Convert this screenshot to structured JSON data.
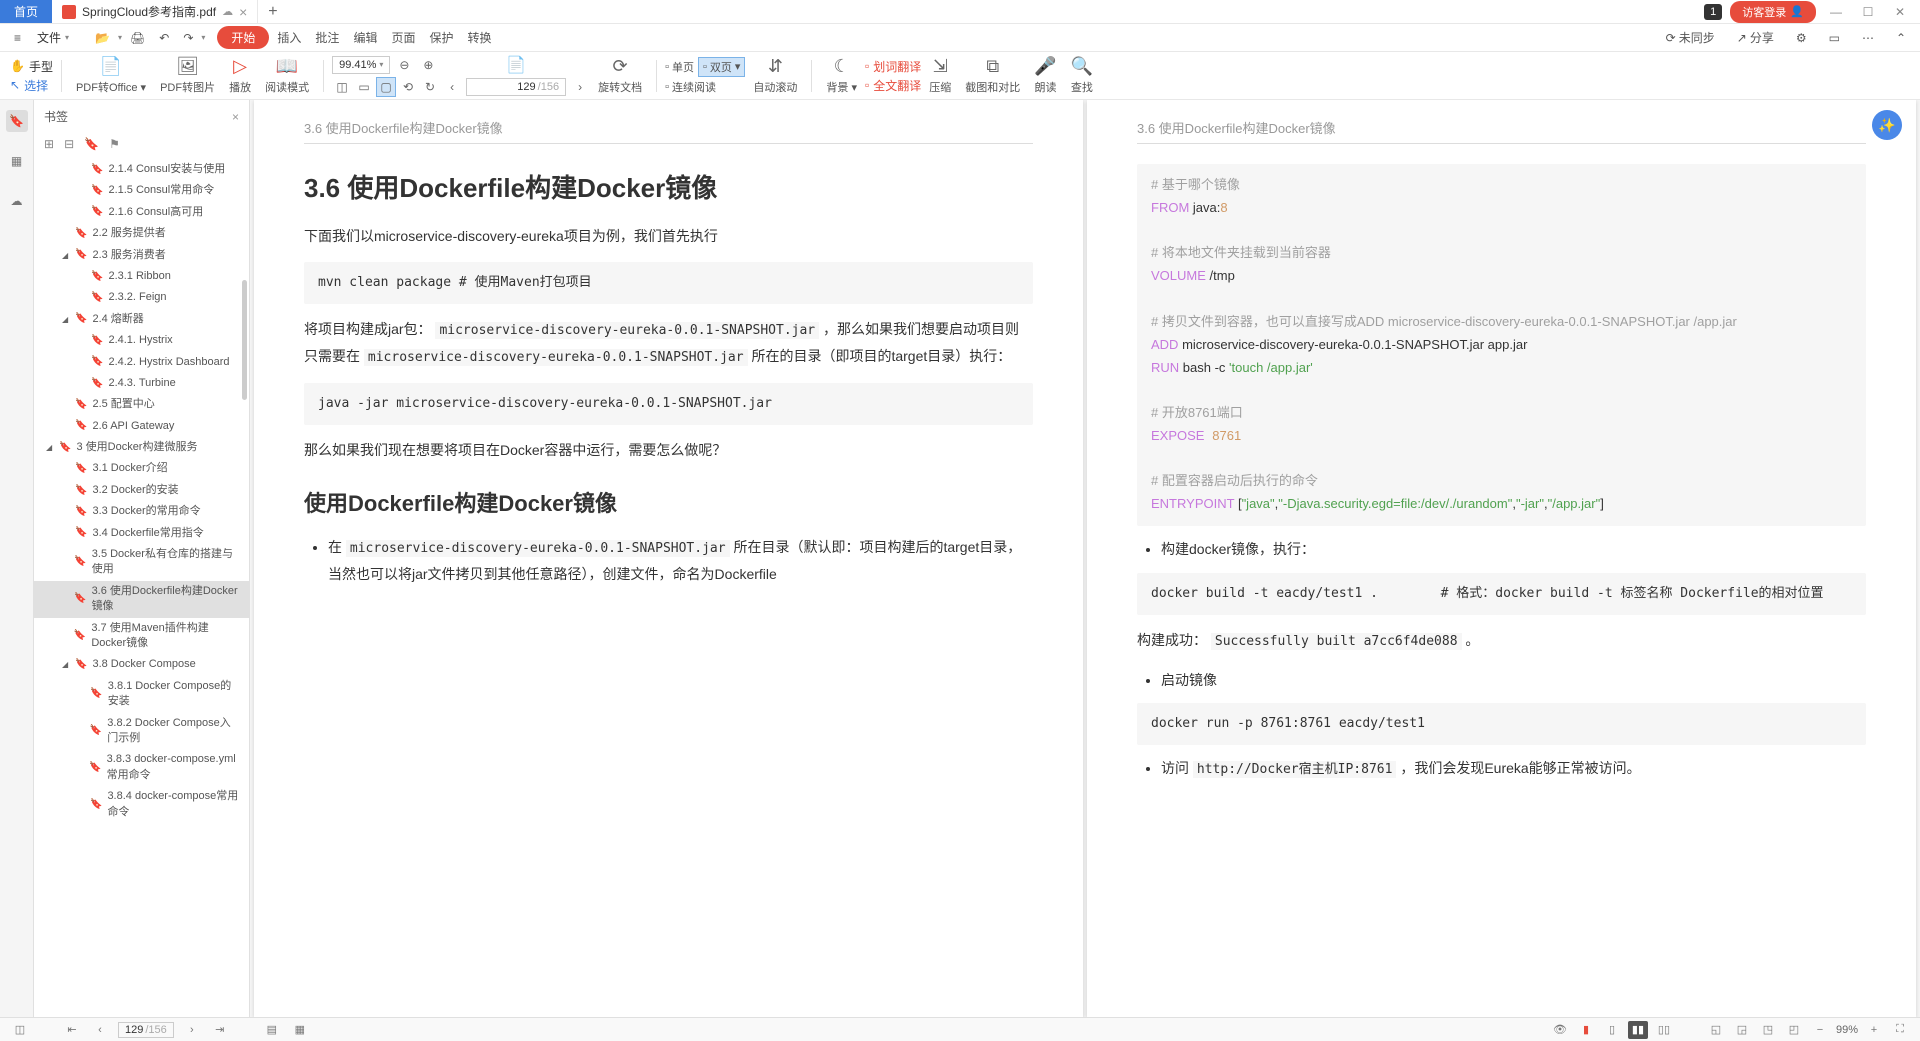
{
  "titlebar": {
    "home": "首页",
    "doc_name": "SpringCloud参考指南.pdf",
    "badge": "1",
    "login": "访客登录"
  },
  "menubar": {
    "file": "文件",
    "start": "开始",
    "insert": "插入",
    "review": "批注",
    "edit": "编辑",
    "page": "页面",
    "protect": "保护",
    "convert": "转换",
    "notsync": "未同步",
    "share": "分享"
  },
  "toolbar": {
    "hand": "手型",
    "select": "选择",
    "pdf2office": "PDF转Office",
    "pdf2img": "PDF转图片",
    "play": "播放",
    "readmode": "阅读模式",
    "zoom": "99.41%",
    "rotate": "旋转文档",
    "singlepage": "单页",
    "doublepage": "双页",
    "contread": "连续阅读",
    "autoscroll": "自动滚动",
    "bg": "背景",
    "seltrans": "划词翻译",
    "fulltrans": "全文翻译",
    "compress": "压缩",
    "imgcmp": "截图和对比",
    "readaloud": "朗读",
    "find": "查找",
    "page_cur": "129",
    "page_total": "/156"
  },
  "bookmark": {
    "title": "书签",
    "items": [
      {
        "label": "2.1.4 Consul安装与使用",
        "lvl": 2
      },
      {
        "label": "2.1.5 Consul常用命令",
        "lvl": 2
      },
      {
        "label": "2.1.6 Consul高可用",
        "lvl": 2
      },
      {
        "label": "2.2 服务提供者",
        "lvl": 1
      },
      {
        "label": "2.3 服务消费者",
        "lvl": 1,
        "exp": true
      },
      {
        "label": "2.3.1 Ribbon",
        "lvl": 2
      },
      {
        "label": "2.3.2. Feign",
        "lvl": 2
      },
      {
        "label": "2.4 熔断器",
        "lvl": 1,
        "exp": true
      },
      {
        "label": "2.4.1. Hystrix",
        "lvl": 2
      },
      {
        "label": "2.4.2. Hystrix Dashboard",
        "lvl": 2
      },
      {
        "label": "2.4.3. Turbine",
        "lvl": 2
      },
      {
        "label": "2.5 配置中心",
        "lvl": 1
      },
      {
        "label": "2.6 API Gateway",
        "lvl": 1
      },
      {
        "label": "3 使用Docker构建微服务",
        "lvl": 0,
        "exp": true
      },
      {
        "label": "3.1 Docker介绍",
        "lvl": 1
      },
      {
        "label": "3.2 Docker的安装",
        "lvl": 1
      },
      {
        "label": "3.3 Docker的常用命令",
        "lvl": 1
      },
      {
        "label": "3.4 Dockerfile常用指令",
        "lvl": 1
      },
      {
        "label": "3.5 Docker私有仓库的搭建与使用",
        "lvl": 1
      },
      {
        "label": "3.6 使用Dockerfile构建Docker镜像",
        "lvl": 1,
        "active": true
      },
      {
        "label": "3.7 使用Maven插件构建Docker镜像",
        "lvl": 1
      },
      {
        "label": "3.8 Docker Compose",
        "lvl": 1,
        "exp": true
      },
      {
        "label": "3.8.1 Docker Compose的安装",
        "lvl": 2
      },
      {
        "label": "3.8.2 Docker Compose入门示例",
        "lvl": 2
      },
      {
        "label": "3.8.3 docker-compose.yml常用命令",
        "lvl": 2
      },
      {
        "label": "3.8.4 docker-compose常用命令",
        "lvl": 2
      }
    ]
  },
  "doc": {
    "header": "3.6 使用Dockerfile构建Docker镜像",
    "left": {
      "h1": "3.6 使用Dockerfile构建Docker镜像",
      "p1a": "下面我们以microservice-discovery-eureka项目为例，我们首先执行",
      "code1": "mvn clean package # 使用Maven打包项目",
      "p2a": "将项目构建成jar包：",
      "p2b": "microservice-discovery-eureka-0.0.1-SNAPSHOT.jar",
      "p2c": "，那么如果我们想要启动项目则只需要在",
      "p2d": "microservice-discovery-eureka-0.0.1-SNAPSHOT.jar",
      "p2e": " 所在的目录（即项目的target目录）执行：",
      "code2": "java -jar microservice-discovery-eureka-0.0.1-SNAPSHOT.jar",
      "p3": "那么如果我们现在想要将项目在Docker容器中运行，需要怎么做呢？",
      "h2": "使用Dockerfile构建Docker镜像",
      "li1a": "在 ",
      "li1b": "microservice-discovery-eureka-0.0.1-SNAPSHOT.jar",
      "li1c": " 所在目录（默认即：项目构建后的target目录，当然也可以将jar文件拷贝到其他任意路径），创建文件，命名为Dockerfile"
    },
    "right": {
      "c1": "# 基于哪个镜像",
      "c2": "FROM",
      "c3": " java:",
      "c4": "8",
      "c5": "# 将本地文件夹挂载到当前容器",
      "c6": "VOLUME",
      "c7": " /tmp",
      "c8": "# 拷贝文件到容器，也可以直接写成ADD microservice-discovery-eureka-0.0.1-SNAPSHOT.jar /app.jar",
      "c9": "ADD",
      "c10": " microservice-discovery-eureka-0.0.1-SNAPSHOT.jar app.jar",
      "c11": "RUN",
      "c12": " bash -c ",
      "c13": "'touch /app.jar'",
      "c14": "# 开放8761端口",
      "c15": "EXPOSE",
      "c16": "8761",
      "c17": "# 配置容器启动后执行的命令",
      "c18": "ENTRYPOINT",
      "c19": " [",
      "c20": "\"java\"",
      "c21": ",",
      "c22": "\"-Djava.security.egd=file:/dev/./urandom\"",
      "c23": ",",
      "c24": "\"-jar\"",
      "c25": ",",
      "c26": "\"/app.jar\"",
      "c27": "]",
      "li_build": "构建docker镜像，执行：",
      "code_build": "docker build -t eacdy/test1 .        # 格式：docker build -t 标签名称 Dockerfile的相对位置",
      "p_success_a": "构建成功：",
      "p_success_b": "Successfully built a7cc6f4de088",
      "p_success_c": " 。",
      "li_start": "启动镜像",
      "code_run": "docker run -p 8761:8761 eacdy/test1",
      "li_visit_a": "访问 ",
      "li_visit_b": "http://Docker宿主机IP:8761",
      "li_visit_c": " ，我们会发现Eureka能够正常被访问。"
    }
  },
  "statusbar": {
    "page_cur": "129",
    "page_total": "/156",
    "zoom": "99%"
  }
}
